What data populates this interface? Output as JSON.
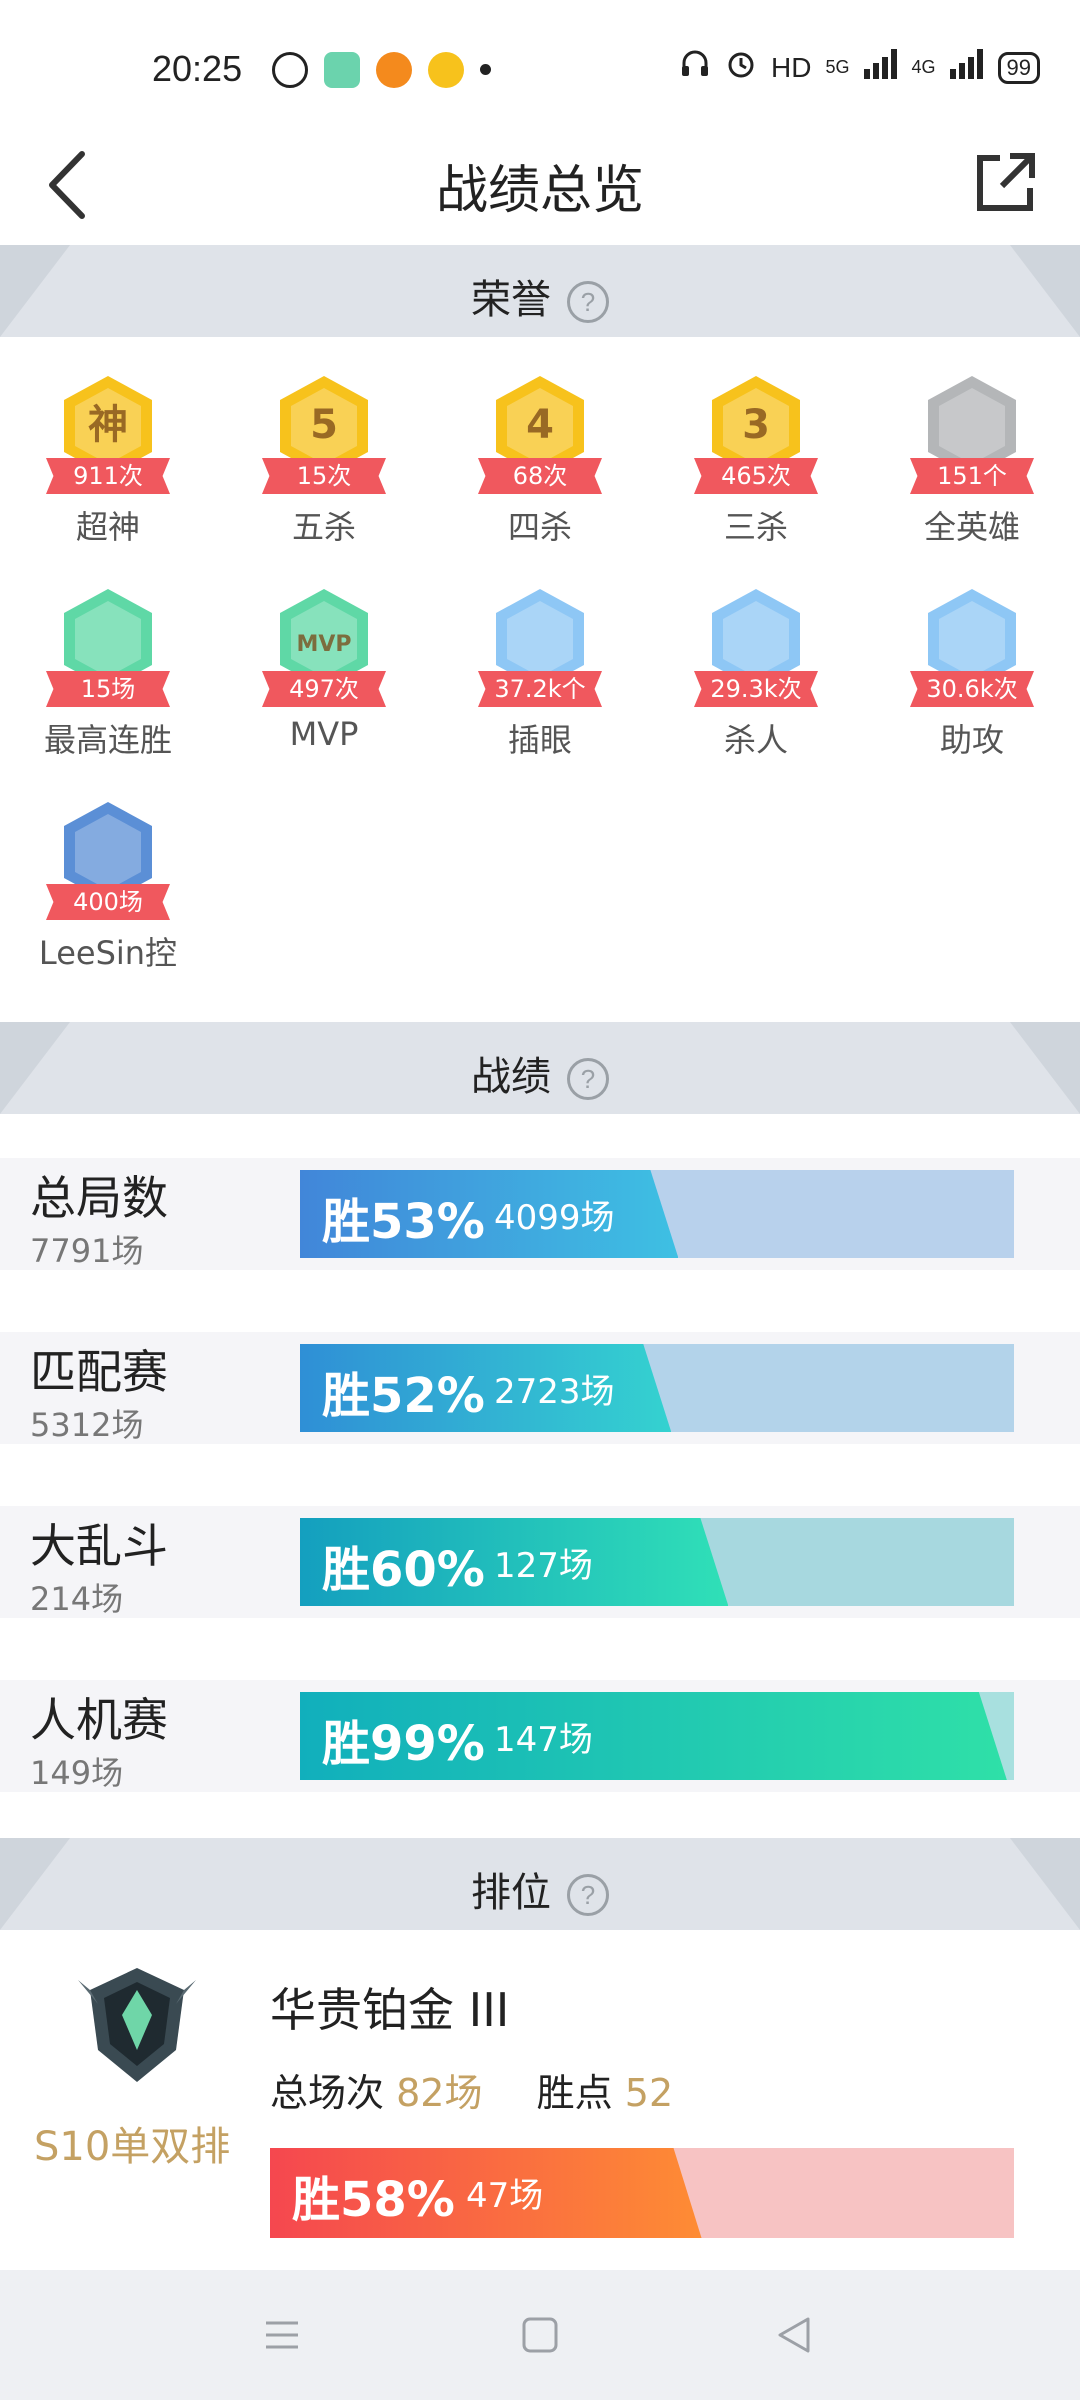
{
  "status_bar": {
    "time": "20:25",
    "hd": "HD",
    "net1": "5G",
    "net2": "4G",
    "battery": "99"
  },
  "header": {
    "title": "战绩总览"
  },
  "sections": {
    "honors": "荣誉",
    "record": "战绩",
    "ranked": "排位",
    "help": "?"
  },
  "honors": [
    {
      "icon": "god-badge-icon",
      "badge_text": "神",
      "count": "911次",
      "label": "超神"
    },
    {
      "icon": "penta-kill-badge-icon",
      "badge_text": "5",
      "count": "15次",
      "label": "五杀"
    },
    {
      "icon": "quadra-kill-badge-icon",
      "badge_text": "4",
      "count": "68次",
      "label": "四杀"
    },
    {
      "icon": "triple-kill-badge-icon",
      "badge_text": "3",
      "count": "465次",
      "label": "三杀"
    },
    {
      "icon": "all-heroes-badge-icon",
      "badge_text": "",
      "count": "151个",
      "label": "全英雄"
    },
    {
      "icon": "win-streak-badge-icon",
      "badge_text": "",
      "count": "15场",
      "label": "最高连胜"
    },
    {
      "icon": "mvp-badge-icon",
      "badge_text": "MVP",
      "count": "497次",
      "label": "MVP"
    },
    {
      "icon": "ward-badge-icon",
      "badge_text": "",
      "count": "37.2k个",
      "label": "插眼"
    },
    {
      "icon": "kill-badge-icon",
      "badge_text": "",
      "count": "29.3k次",
      "label": "杀人"
    },
    {
      "icon": "assist-badge-icon",
      "badge_text": "",
      "count": "30.6k次",
      "label": "助攻"
    },
    {
      "icon": "champion-mastery-badge-icon",
      "badge_text": "",
      "count": "400场",
      "label": "LeeSin控"
    }
  ],
  "stats": [
    {
      "name": "总局数",
      "games": "7791场",
      "win_label": "胜53%",
      "win_rate": 0.53,
      "wins": "4099场"
    },
    {
      "name": "匹配赛",
      "games": "5312场",
      "win_label": "胜52%",
      "win_rate": 0.52,
      "wins": "2723场"
    },
    {
      "name": "大乱斗",
      "games": "214场",
      "win_label": "胜60%",
      "win_rate": 0.6,
      "wins": "127场"
    },
    {
      "name": "人机赛",
      "games": "149场",
      "win_label": "胜99%",
      "win_rate": 0.99,
      "wins": "147场"
    }
  ],
  "ranked": {
    "queue": "S10单双排",
    "tier": "华贵铂金 III",
    "total_label": "总场次",
    "total_value": "82场",
    "points_label": "胜点",
    "points_value": "52",
    "win_label": "胜58%",
    "win_rate": 0.58,
    "wins": "47场"
  },
  "colors": {
    "gold_badge": "#f7c21c",
    "green_badge": "#5fd8a6",
    "blue_badge": "#8ec7f5",
    "grey_badge": "#b4b6b8",
    "ribbon": "#f0585e",
    "accent_gold": "#c4a163"
  }
}
